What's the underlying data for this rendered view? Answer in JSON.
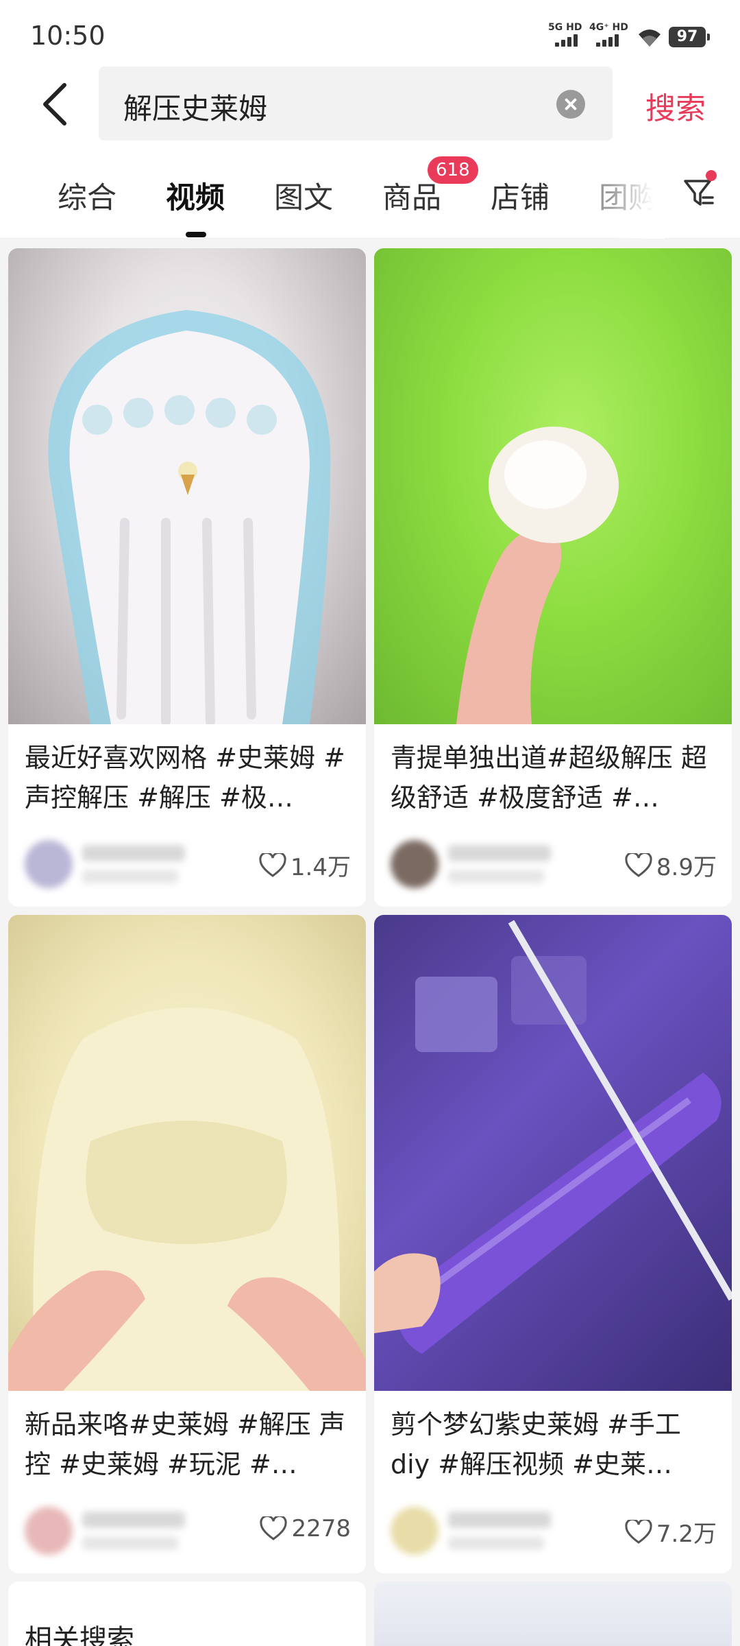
{
  "status": {
    "time": "10:50",
    "net1": "5G HD",
    "net2": "4G⁺ HD",
    "battery": "97"
  },
  "search": {
    "query": "解压史莱姆",
    "button": "搜索"
  },
  "tabs": [
    {
      "label": "综合"
    },
    {
      "label": "视频",
      "active": true
    },
    {
      "label": "图文"
    },
    {
      "label": "商品",
      "badge": "618"
    },
    {
      "label": "店铺"
    },
    {
      "label": "团购"
    }
  ],
  "cards": [
    {
      "title": "最近好喜欢网格 #史莱姆 #声控解压 #解压 #极…",
      "likes": "1.4万"
    },
    {
      "title": "青提单独出道#超级解压 超级舒适 #极度舒适 #…",
      "likes": "8.9万"
    },
    {
      "title": "新品来咯#史莱姆 #解压 声控 #史莱姆 #玩泥 #…",
      "likes": "2278"
    },
    {
      "title": "剪个梦幻紫史莱姆 #手工 diy #解压视频 #史莱…",
      "likes": "7.2万"
    }
  ],
  "related": {
    "title": "相关搜索"
  },
  "colors": {
    "accent": "#ea3a5a"
  }
}
